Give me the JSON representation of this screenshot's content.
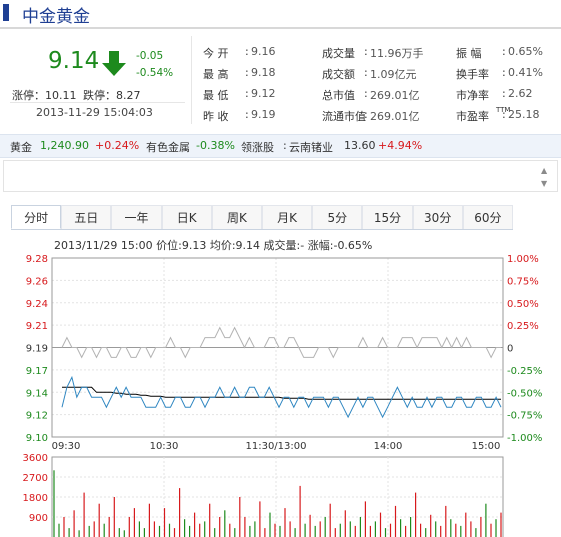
{
  "title": "中金黄金",
  "quote": {
    "price": "9.14",
    "change": "-0.05",
    "change_pct": "-0.54%",
    "limit_up_label": "涨停",
    "limit_up": "10.11",
    "limit_down_label": "跌停",
    "limit_down": "8.27",
    "datetime": "2013-11-29 15:04:03",
    "arrow": "down-arrow-icon",
    "colors": {
      "down": "#1d8a1d",
      "up": "#d7191c",
      "accent": "#1f3f93"
    }
  },
  "fields_col1": [
    {
      "label": "今  开",
      "value": "9.16"
    },
    {
      "label": "最  高",
      "value": "9.18"
    },
    {
      "label": "最  低",
      "value": "9.12"
    },
    {
      "label": "昨  收",
      "value": "9.19"
    }
  ],
  "fields_col2": [
    {
      "label": "成交量",
      "value": "11.96万手"
    },
    {
      "label": "成交额",
      "value": "1.09亿元"
    },
    {
      "label": "总市值",
      "value": "269.01亿"
    },
    {
      "label": "流通市值",
      "value": "269.01亿"
    }
  ],
  "fields_col3": [
    {
      "label": "振  幅",
      "value": "0.65%"
    },
    {
      "label": "换手率",
      "value": "0.41%"
    },
    {
      "label": "市净率",
      "value": "2.62"
    },
    {
      "label": "市盈率",
      "sup": "TTM",
      "value": "25.18"
    }
  ],
  "index_row": {
    "gold_label": "黄金",
    "gold_value": "1,240.90",
    "gold_change": "+0.24%",
    "sector_label": "有色金属",
    "sector_change": "-0.38%",
    "leader_label": "领涨股",
    "leader_name": "云南锗业",
    "leader_price": "13.60",
    "leader_change": "+4.94%"
  },
  "tabs": [
    "分时",
    "五日",
    "一年",
    "日K",
    "周K",
    "月K",
    "5分",
    "15分",
    "30分",
    "60分"
  ],
  "active_tab": 0,
  "chart_info": {
    "date": "2013/11/29 15:00",
    "price_label": "价位",
    "price": "9.13",
    "avg_label": "均价",
    "avg": "9.14",
    "vol_label": "成交量",
    "vol": "-",
    "amp_label": "涨幅",
    "amp": "-0.65%"
  },
  "chart_data": {
    "type": "line",
    "title": "",
    "y_ticks": [
      "9.28",
      "9.26",
      "9.24",
      "9.21",
      "9.19",
      "9.17",
      "9.14",
      "9.12",
      "9.10"
    ],
    "y_tick_colors": [
      "#d7191c",
      "#d7191c",
      "#d7191c",
      "#d7191c",
      "#333333",
      "#1d8a1d",
      "#1d8a1d",
      "#1d8a1d",
      "#1d8a1d"
    ],
    "pct_ticks": [
      "1.00%",
      "0.75%",
      "0.50%",
      "0.25%",
      "0",
      "-0.25%",
      "-0.50%",
      "-0.75%",
      "-1.00%"
    ],
    "x_ticks": [
      "09:30",
      "10:30",
      "11:30/13:00",
      "14:00",
      "15:00"
    ],
    "ylim": [
      9.1,
      9.28
    ],
    "prev_close": 9.19,
    "series": [
      {
        "color": "#2e86c1",
        "values": [
          9.13,
          9.15,
          9.16,
          9.14,
          9.15,
          9.15,
          9.14,
          9.14,
          9.14,
          9.13,
          9.14,
          9.15,
          9.14,
          9.15,
          9.14,
          9.14,
          9.14,
          9.13,
          9.13,
          9.13,
          9.14,
          9.13,
          9.13,
          9.14,
          9.14,
          9.13,
          9.13,
          9.14,
          9.14,
          9.13,
          9.14,
          9.14,
          9.15,
          9.14,
          9.14,
          9.15,
          9.14,
          9.14,
          9.15,
          9.15,
          9.14,
          9.14,
          9.15,
          9.14,
          9.13,
          9.14,
          9.14,
          9.13,
          9.14,
          9.14,
          9.13,
          9.14,
          9.14,
          9.14,
          9.13,
          9.14,
          9.14,
          9.13,
          9.12,
          9.13,
          9.14,
          9.13,
          9.14,
          9.14,
          9.13,
          9.12,
          9.13,
          9.14,
          9.15,
          9.14,
          9.13,
          9.14,
          9.13,
          9.13,
          9.14,
          9.13,
          9.14,
          9.14,
          9.13,
          9.13,
          9.14,
          9.14,
          9.13,
          9.13,
          9.14,
          9.14,
          9.13,
          9.13,
          9.14,
          9.13
        ]
      },
      {
        "color": "#000000",
        "values": [
          9.15,
          9.15,
          9.15,
          9.15,
          9.15,
          9.15,
          9.15,
          9.145,
          9.145,
          9.145,
          9.145,
          9.144,
          9.144,
          9.143,
          9.143,
          9.143,
          9.142,
          9.142,
          9.141,
          9.141,
          9.141,
          9.14,
          9.14,
          9.14,
          9.14,
          9.14,
          9.14,
          9.14,
          9.14,
          9.14,
          9.14,
          9.14,
          9.14,
          9.14,
          9.14,
          9.14,
          9.14,
          9.14,
          9.14,
          9.14,
          9.14,
          9.14,
          9.14,
          9.14,
          9.14,
          9.139,
          9.139,
          9.139,
          9.139,
          9.139,
          9.138,
          9.138,
          9.138,
          9.138,
          9.138,
          9.138,
          9.138,
          9.138,
          9.138,
          9.138,
          9.138,
          9.138,
          9.138,
          9.138,
          9.138,
          9.138,
          9.138,
          9.138,
          9.138,
          9.138,
          9.138,
          9.138,
          9.138,
          9.138,
          9.138,
          9.138,
          9.138,
          9.138,
          9.138,
          9.138,
          9.138,
          9.138,
          9.138,
          9.138,
          9.138,
          9.138,
          9.138,
          9.138,
          9.138,
          9.138
        ]
      },
      {
        "color": "#b3b3b3",
        "values": [
          9.19,
          9.2,
          9.19,
          9.19,
          9.18,
          9.19,
          9.19,
          9.18,
          9.19,
          9.19,
          9.18,
          9.18,
          9.19,
          9.19,
          9.18,
          9.18,
          9.19,
          9.19,
          9.18,
          9.19,
          9.19,
          9.19,
          9.2,
          9.19,
          9.19,
          9.18,
          9.19,
          9.19,
          9.19,
          9.2,
          9.2,
          9.2,
          9.21,
          9.2,
          9.2,
          9.21,
          9.2,
          9.19,
          9.2,
          9.19,
          9.19,
          9.19,
          9.2,
          9.2,
          9.19,
          9.19,
          9.2,
          9.2,
          9.19,
          9.18,
          9.18,
          9.18,
          9.19,
          9.19,
          9.19,
          9.18,
          9.19,
          9.19,
          9.19,
          9.19,
          9.19,
          9.2,
          9.19,
          9.19,
          9.19,
          9.2,
          9.19,
          9.19,
          9.19,
          9.2,
          9.2,
          9.2,
          9.19,
          9.2,
          9.2,
          9.2,
          9.2,
          9.19,
          9.2,
          9.19,
          9.2,
          9.19,
          9.2,
          9.19,
          9.19,
          9.19,
          9.19,
          9.18,
          9.19,
          9.19
        ]
      }
    ]
  },
  "volume_chart": {
    "type": "bar",
    "y_ticks": [
      "3600",
      "2700",
      "1800",
      "900"
    ],
    "ylim": [
      0,
      3600
    ],
    "colors": {
      "up": "#d7191c",
      "down": "#1d8a1d"
    },
    "values": [
      3000,
      600,
      900,
      400,
      1200,
      300,
      2000,
      500,
      700,
      1500,
      600,
      900,
      1800,
      400,
      300,
      900,
      1300,
      700,
      400,
      1500,
      700,
      500,
      1300,
      600,
      400,
      2200,
      800,
      500,
      1100,
      600,
      700,
      1500,
      400,
      900,
      1200,
      600,
      400,
      1800,
      900,
      500,
      700,
      1600,
      400,
      1100,
      600,
      500,
      1300,
      700,
      400,
      2300,
      600,
      1000,
      500,
      700,
      900,
      1500,
      400,
      600,
      1200,
      700,
      500,
      900,
      1600,
      500,
      700,
      1100,
      400,
      600,
      1400,
      800,
      500,
      900,
      2000,
      600,
      400,
      1000,
      700,
      500,
      1400,
      800,
      600,
      500,
      1100,
      700,
      400,
      900,
      1500,
      600,
      800,
      1100
    ],
    "directions": [
      "d",
      "d",
      "u",
      "d",
      "u",
      "d",
      "u",
      "d",
      "u",
      "u",
      "d",
      "u",
      "u",
      "d",
      "d",
      "u",
      "u",
      "d",
      "d",
      "u",
      "u",
      "d",
      "u",
      "d",
      "u",
      "u",
      "d",
      "d",
      "u",
      "u",
      "d",
      "u",
      "d",
      "u",
      "d",
      "u",
      "d",
      "u",
      "u",
      "d",
      "d",
      "u",
      "u",
      "d",
      "u",
      "d",
      "u",
      "u",
      "d",
      "u",
      "d",
      "u",
      "d",
      "u",
      "d",
      "u",
      "u",
      "d",
      "u",
      "d",
      "u",
      "d",
      "u",
      "u",
      "d",
      "u",
      "d",
      "u",
      "u",
      "d",
      "u",
      "d",
      "u",
      "u",
      "d",
      "u",
      "d",
      "u",
      "u",
      "d",
      "u",
      "d",
      "u",
      "u",
      "d",
      "u",
      "d",
      "u",
      "d",
      "u"
    ]
  }
}
